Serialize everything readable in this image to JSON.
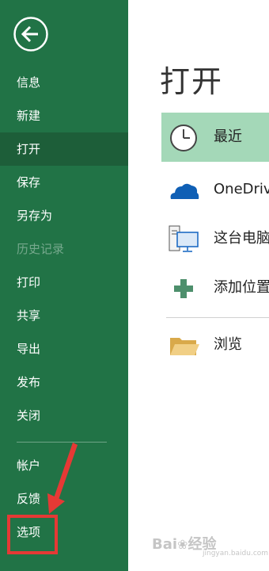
{
  "nav": {
    "back_icon": "back-arrow-circle-icon",
    "items": [
      {
        "label": "信息",
        "state": "normal"
      },
      {
        "label": "新建",
        "state": "normal"
      },
      {
        "label": "打开",
        "state": "active"
      },
      {
        "label": "保存",
        "state": "normal"
      },
      {
        "label": "另存为",
        "state": "normal"
      },
      {
        "label": "历史记录",
        "state": "disabled"
      },
      {
        "label": "打印",
        "state": "normal"
      },
      {
        "label": "共享",
        "state": "normal"
      },
      {
        "label": "导出",
        "state": "normal"
      },
      {
        "label": "发布",
        "state": "normal"
      },
      {
        "label": "关闭",
        "state": "normal"
      },
      {
        "label": "帐户",
        "state": "normal"
      },
      {
        "label": "反馈",
        "state": "normal"
      },
      {
        "label": "选项",
        "state": "normal"
      }
    ]
  },
  "main": {
    "title": "打开",
    "locations": [
      {
        "label": "最近",
        "icon": "clock-icon",
        "selected": true
      },
      {
        "label": "OneDrive",
        "icon": "onedrive-cloud-icon",
        "selected": false
      },
      {
        "label": "这台电脑",
        "icon": "this-pc-icon",
        "selected": false
      },
      {
        "label": "添加位置",
        "icon": "add-place-icon",
        "selected": false
      },
      {
        "label": "浏览",
        "icon": "folder-icon",
        "selected": false
      }
    ]
  },
  "annotation": {
    "highlight_color": "#e53935"
  },
  "watermark": {
    "text": "Bai",
    "text2": "经验",
    "sub": "jingyan.baidu.com"
  },
  "colors": {
    "sidebar_bg": "#217346",
    "active_item_bg": "#1d5e39",
    "selected_location_bg": "#a4d8b8"
  }
}
